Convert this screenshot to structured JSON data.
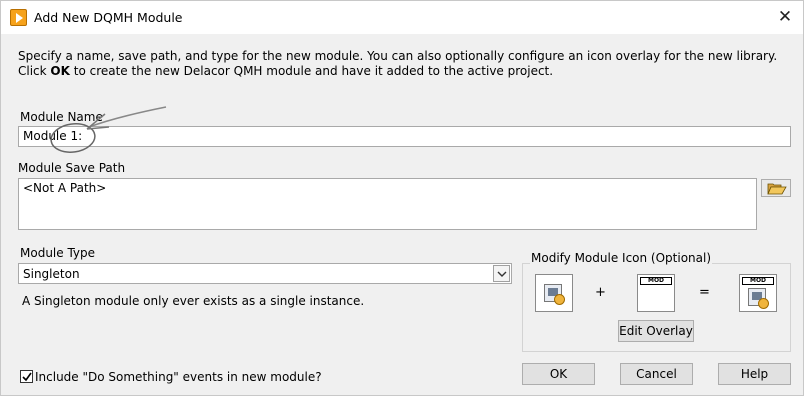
{
  "window": {
    "title": "Add New DQMH Module",
    "close_glyph": "✕"
  },
  "description": {
    "text_before": "Specify a name, save path, and type for the new module. You can also optionally configure an icon overlay for the new library. Click ",
    "bold": "OK",
    "text_after": " to create the new Delacor QMH module and have it added to the active project."
  },
  "module_name": {
    "label": "Module Name",
    "value": "Module 1:"
  },
  "save_path": {
    "label": "Module Save Path",
    "value": "<Not A Path>",
    "browse_icon": "folder-open-icon"
  },
  "module_type": {
    "label": "Module Type",
    "selected": "Singleton",
    "help_text": "A Singleton module only ever exists as a single instance."
  },
  "icon_group": {
    "title": "Modify Module Icon (Optional)",
    "plus": "+",
    "equals": "=",
    "overlay_tag": "MOD",
    "result_tag": "MOD",
    "edit_overlay_label": "Edit Overlay"
  },
  "include_events": {
    "label": "Include \"Do Something\" events in new module?",
    "checked": true
  },
  "buttons": {
    "ok": "OK",
    "cancel": "Cancel",
    "help": "Help"
  },
  "colors": {
    "window_bg": "#f0f0f0",
    "app_icon": "#f6a21b",
    "annotation_stroke": "#777777"
  }
}
